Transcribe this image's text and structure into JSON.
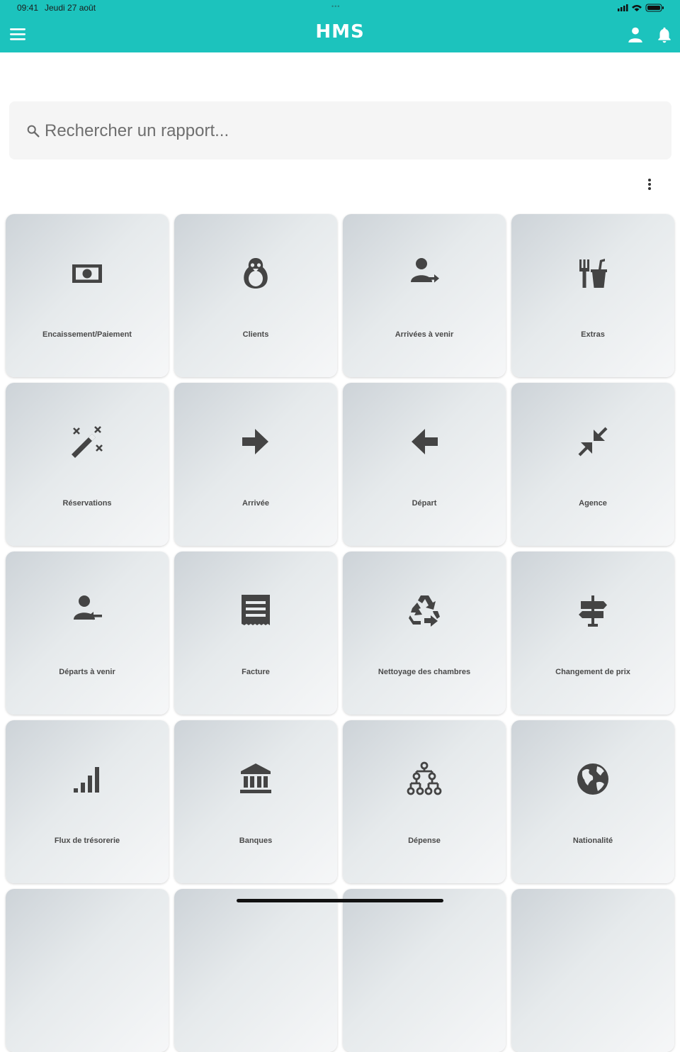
{
  "status_bar": {
    "time": "09:41",
    "date": "Jeudi 27 août",
    "dots": "•••"
  },
  "header": {
    "title": "HMS",
    "color": "#1cc3bd"
  },
  "search": {
    "placeholder": "Rechercher un rapport..."
  },
  "tiles": [
    {
      "label": "Encaissement/Paiement",
      "icon": "money-icon"
    },
    {
      "label": "Clients",
      "icon": "penguin-icon"
    },
    {
      "label": "Arrivées à venir",
      "icon": "person-arrow-right-icon"
    },
    {
      "label": "Extras",
      "icon": "food-drink-icon"
    },
    {
      "label": "Réservations",
      "icon": "magic-wand-icon"
    },
    {
      "label": "Arrivée",
      "icon": "arrow-right-icon"
    },
    {
      "label": "Départ",
      "icon": "arrow-left-icon"
    },
    {
      "label": "Agence",
      "icon": "compress-arrows-icon"
    },
    {
      "label": "Départs à venir",
      "icon": "person-arrow-left-icon"
    },
    {
      "label": "Facture",
      "icon": "receipt-icon"
    },
    {
      "label": "Nettoyage des chambres",
      "icon": "recycle-icon"
    },
    {
      "label": "Changement de prix",
      "icon": "signpost-icon"
    },
    {
      "label": "Flux de trésorerie",
      "icon": "signal-bars-icon"
    },
    {
      "label": "Banques",
      "icon": "bank-icon"
    },
    {
      "label": "Dépense",
      "icon": "hierarchy-icon"
    },
    {
      "label": "Nationalité",
      "icon": "globe-icon"
    }
  ]
}
